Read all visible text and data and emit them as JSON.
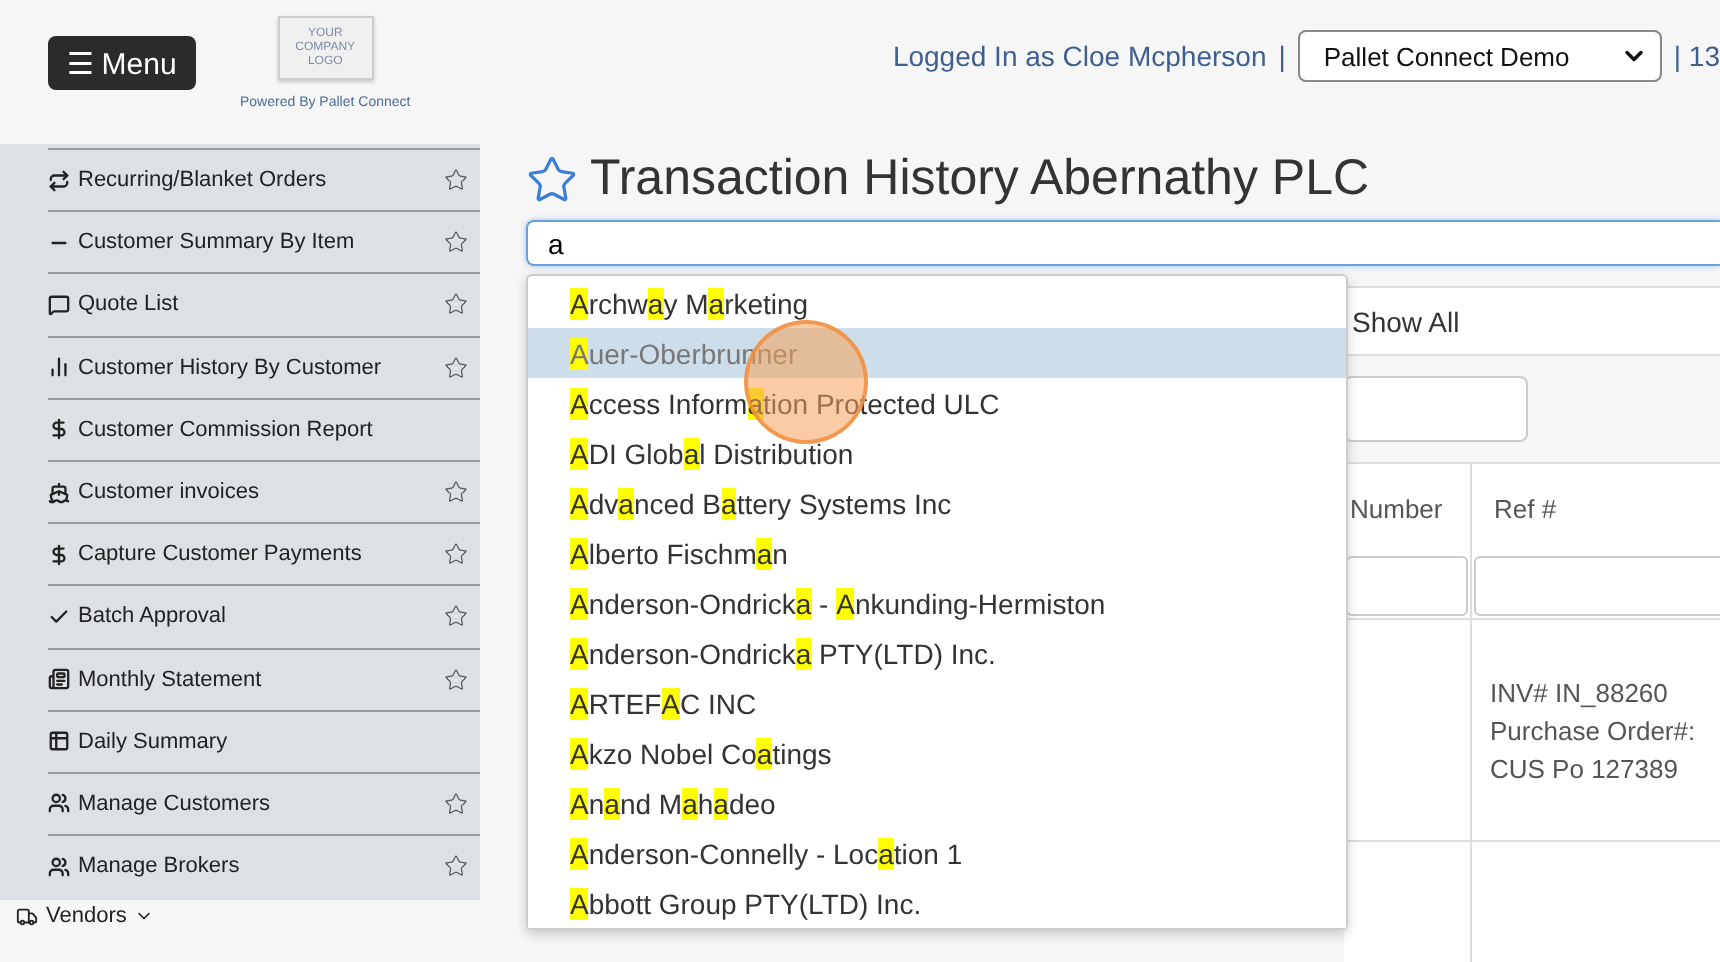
{
  "header": {
    "menu_button": "☰ Menu",
    "logo_lines": [
      "YOUR",
      "COMPANY",
      "LOGO"
    ],
    "powered_by": "Powered By Pallet Connect",
    "logged_in": "Logged In as Cloe Mcpherson",
    "separator": "|",
    "company_select": "Pallet Connect Demo",
    "trailing": "| 13"
  },
  "sidebar": {
    "items": [
      {
        "label": "Recurring/Blanket Orders",
        "favorite_star": true
      },
      {
        "label": "Customer Summary By Item",
        "favorite_star": true
      },
      {
        "label": "Quote List",
        "favorite_star": true
      },
      {
        "label": "Customer History By Customer",
        "favorite_star": true
      },
      {
        "label": "Customer Commission Report",
        "favorite_star": false
      },
      {
        "label": "Customer invoices",
        "favorite_star": true
      },
      {
        "label": "Capture Customer Payments",
        "favorite_star": true
      },
      {
        "label": "Batch Approval",
        "favorite_star": true
      },
      {
        "label": "Monthly Statement",
        "favorite_star": true
      },
      {
        "label": "Daily Summary",
        "favorite_star": false
      },
      {
        "label": "Manage Customers",
        "favorite_star": true
      },
      {
        "label": "Manage Brokers",
        "favorite_star": true
      }
    ],
    "section": {
      "label": "Vendors",
      "expanded": false
    }
  },
  "page": {
    "title": "Transaction History Abernathy PLC",
    "search": {
      "value": "a"
    },
    "suggestions": [
      {
        "selected": false,
        "parts": [
          {
            "text": "A",
            "match": true
          },
          {
            "text": "rchw",
            "match": false
          },
          {
            "text": "a",
            "match": true
          },
          {
            "text": "y M",
            "match": false
          },
          {
            "text": "a",
            "match": true
          },
          {
            "text": "rketing",
            "match": false
          }
        ]
      },
      {
        "selected": true,
        "parts": [
          {
            "text": "A",
            "match": true
          },
          {
            "text": "uer-Oberbrunner",
            "match": false
          }
        ]
      },
      {
        "selected": false,
        "parts": [
          {
            "text": "A",
            "match": true
          },
          {
            "text": "ccess Inform",
            "match": false
          },
          {
            "text": "a",
            "match": true
          },
          {
            "text": "tion Protected ULC",
            "match": false
          }
        ]
      },
      {
        "selected": false,
        "parts": [
          {
            "text": "A",
            "match": true
          },
          {
            "text": "DI Glob",
            "match": false
          },
          {
            "text": "a",
            "match": true
          },
          {
            "text": "l Distribution",
            "match": false
          }
        ]
      },
      {
        "selected": false,
        "parts": [
          {
            "text": "A",
            "match": true
          },
          {
            "text": "dv",
            "match": false
          },
          {
            "text": "a",
            "match": true
          },
          {
            "text": "nced B",
            "match": false
          },
          {
            "text": "a",
            "match": true
          },
          {
            "text": "ttery Systems Inc",
            "match": false
          }
        ]
      },
      {
        "selected": false,
        "parts": [
          {
            "text": "A",
            "match": true
          },
          {
            "text": "lberto Fischm",
            "match": false
          },
          {
            "text": "a",
            "match": true
          },
          {
            "text": "n",
            "match": false
          }
        ]
      },
      {
        "selected": false,
        "parts": [
          {
            "text": "A",
            "match": true
          },
          {
            "text": "nderson-Ondrick",
            "match": false
          },
          {
            "text": "a",
            "match": true
          },
          {
            "text": " - ",
            "match": false
          },
          {
            "text": "A",
            "match": true
          },
          {
            "text": "nkunding-Hermiston",
            "match": false
          }
        ]
      },
      {
        "selected": false,
        "parts": [
          {
            "text": "A",
            "match": true
          },
          {
            "text": "nderson-Ondrick",
            "match": false
          },
          {
            "text": "a",
            "match": true
          },
          {
            "text": " PTY(LTD) Inc.",
            "match": false
          }
        ]
      },
      {
        "selected": false,
        "parts": [
          {
            "text": "A",
            "match": true
          },
          {
            "text": "RTEF",
            "match": false
          },
          {
            "text": "A",
            "match": true
          },
          {
            "text": "C INC",
            "match": false
          }
        ]
      },
      {
        "selected": false,
        "parts": [
          {
            "text": "A",
            "match": true
          },
          {
            "text": "kzo Nobel Co",
            "match": false
          },
          {
            "text": "a",
            "match": true
          },
          {
            "text": "tings",
            "match": false
          }
        ]
      },
      {
        "selected": false,
        "parts": [
          {
            "text": "A",
            "match": true
          },
          {
            "text": "n",
            "match": false
          },
          {
            "text": "a",
            "match": true
          },
          {
            "text": "nd M",
            "match": false
          },
          {
            "text": "a",
            "match": true
          },
          {
            "text": "h",
            "match": false
          },
          {
            "text": "a",
            "match": true
          },
          {
            "text": "deo",
            "match": false
          }
        ]
      },
      {
        "selected": false,
        "parts": [
          {
            "text": "A",
            "match": true
          },
          {
            "text": "nderson-Connelly - Loc",
            "match": false
          },
          {
            "text": "a",
            "match": true
          },
          {
            "text": "tion 1",
            "match": false
          }
        ]
      },
      {
        "selected": false,
        "parts": [
          {
            "text": "A",
            "match": true
          },
          {
            "text": "bbott Group PTY(LTD) Inc.",
            "match": false
          }
        ]
      }
    ],
    "filter_select": "Show All",
    "table": {
      "columns": [
        "Number",
        "Ref #"
      ],
      "rows": [
        {
          "ref_lines": [
            "INV# IN_88260",
            "Purchase Order#:",
            "CUS Po 127389"
          ]
        }
      ]
    }
  }
}
